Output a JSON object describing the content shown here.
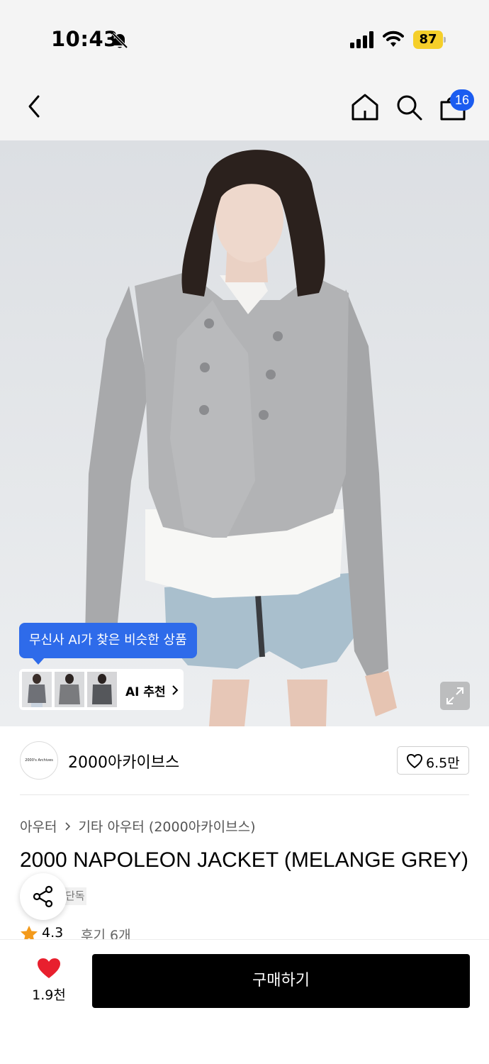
{
  "status_bar": {
    "time": "10:43",
    "battery": "87"
  },
  "nav": {
    "cart_count": "16"
  },
  "image": {
    "ai_tooltip": "무신사 AI가 찾은 비슷한 상품",
    "ai_recommend_label": "AI 추천"
  },
  "brand": {
    "name": "2000아카이브스",
    "logo_text": "2000's Archives",
    "likes": "6.5만"
  },
  "product": {
    "breadcrumb": [
      "아우터",
      "기타 아우터 (2000아카이브스)"
    ],
    "title": "2000 NAPOLEON JACKET (MELANGE GREY)",
    "exclusive_tag": "단독",
    "rating": "4.3",
    "review_label": "후기 6개"
  },
  "bottom_bar": {
    "wish_count": "1.9천",
    "buy_label": "구매하기"
  },
  "colors": {
    "accent_blue": "#2e6bea",
    "badge_blue": "#1b5cf0",
    "battery_yellow": "#f5cf2a",
    "heart_red": "#e8202e",
    "star_orange": "#f39a1b"
  }
}
